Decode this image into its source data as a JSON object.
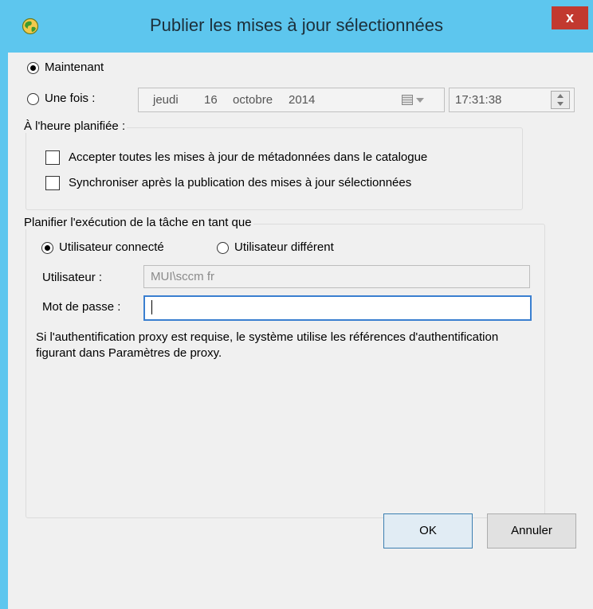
{
  "window": {
    "title": "Publier les mises à jour sélectionnées",
    "close_label": "x",
    "app_icon": "globe-icon"
  },
  "schedule": {
    "now_label": "Maintenant",
    "now_selected": true,
    "once_label": "Une fois :",
    "date": {
      "weekday": "jeudi",
      "day": "16",
      "month": "octobre",
      "year": "2014"
    },
    "time": "17:31:38"
  },
  "scheduled_group": {
    "legend": "À l'heure planifiée :",
    "accept_metadata_label": "Accepter toutes les mises à jour de métadonnées dans le catalogue",
    "sync_label": "Synchroniser après la publication des mises à jour sélectionnées"
  },
  "run_as_group": {
    "legend": "Planifier l'exécution de la tâche en tant que",
    "connected_user_label": "Utilisateur connecté",
    "different_user_label": "Utilisateur différent",
    "user_label": "Utilisateur :",
    "user_value": "MUI\\sccm fr",
    "password_label": "Mot de passe :",
    "password_value": "",
    "note": "Si l'authentification proxy est requise, le système utilise les références d'authentification figurant dans Paramètres de proxy."
  },
  "buttons": {
    "ok": "OK",
    "cancel": "Annuler"
  },
  "colors": {
    "title_bar": "#5dc6ee",
    "close_button": "#c2392f",
    "dialog_background": "#f0f0f0",
    "focus_border": "#3a7fd0"
  }
}
